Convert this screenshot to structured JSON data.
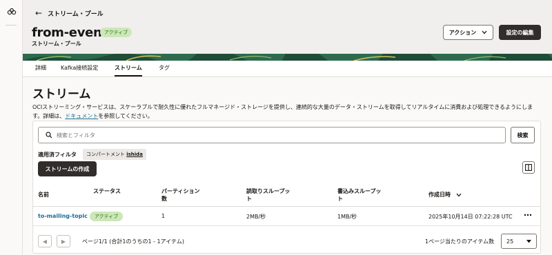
{
  "nav": {
    "logo_icon": "oci-logo-icon"
  },
  "header": {
    "back_label": "ストリーム・プール",
    "title": "from-event",
    "status": "アクティブ",
    "subtitle": "ストリーム・プール",
    "action_label": "アクション",
    "edit_label": "設定の編集"
  },
  "tabs": [
    "詳細",
    "Kafka接続設定",
    "ストリーム",
    "タグ"
  ],
  "section": {
    "title": "ストリーム",
    "desc_before": "OCIストリーミング・サービスは、スケーラブルで耐久性に優れたフルマネージド・ストレージを提供し、連続的な大量のデータ・ストリームを取得してリアルタイムに消費および処理できるようにします。詳細は、",
    "desc_link": "ドキュメント",
    "desc_after": "を参照してください。"
  },
  "search": {
    "placeholder": "検索とフィルタ",
    "button": "検索"
  },
  "filters": {
    "label": "適用済フィルタ",
    "chip_prefix": "コンパートメント",
    "chip_value": "ishida"
  },
  "create_button": "ストリームの作成",
  "table": {
    "headers": [
      "名前",
      "ステータス",
      "パーティション数",
      "読取りスループット",
      "書込みスループット",
      "作成日時"
    ],
    "rows": [
      {
        "name": "to-mailing-topic",
        "status": "アクティブ",
        "partitions": "1",
        "read": "2MB/秒",
        "write": "1MB/秒",
        "created": "2025年10月14日 07:22:28 UTC"
      }
    ]
  },
  "pager": {
    "text": "ページ1/1 (合計1のうちの1 - 1アイテム)",
    "perpage_label": "1ページ当たりのアイテム数",
    "perpage_value": "25"
  },
  "colors": {
    "accent": "#312d2a",
    "link": "#1b6e93",
    "success_bg": "#cce7b8",
    "success_text": "#2f6b1e"
  }
}
